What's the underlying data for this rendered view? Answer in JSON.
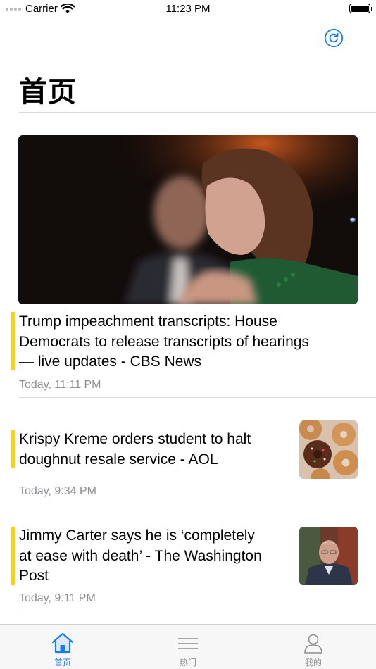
{
  "status_bar": {
    "carrier": "Carrier",
    "time": "11:23 PM"
  },
  "header": {
    "title": "首页",
    "refresh_icon": "refresh-icon"
  },
  "colors": {
    "accent": "#f7d11c",
    "tint": "#1a7cf5",
    "secondary_text": "#8e8e93"
  },
  "feed": {
    "hero": {
      "headline": "Trump impeachment transcripts: House Democrats to release transcripts of hearings — live updates - CBS News",
      "headline_lines": [
        "Trump impeachment transcripts: House",
        "Democrats to release transcripts of hearings",
        "— live updates - CBS News"
      ],
      "timestamp": "Today, 11:11 PM"
    },
    "items": [
      {
        "headline_lines": [
          "Krispy Kreme orders student to halt",
          "doughnut resale service - AOL"
        ],
        "timestamp": "Today, 9:34 PM"
      },
      {
        "headline_lines": [
          "Jimmy Carter says he is ‘completely",
          "at ease with death’ - The Washington",
          "Post"
        ],
        "timestamp": "Today, 9:11 PM"
      }
    ]
  },
  "tab_bar": {
    "tabs": [
      {
        "label": "首页",
        "icon": "home-icon",
        "active": true
      },
      {
        "label": "热门",
        "icon": "menu-lines-icon",
        "active": false
      },
      {
        "label": "我的",
        "icon": "person-icon",
        "active": false
      }
    ]
  }
}
